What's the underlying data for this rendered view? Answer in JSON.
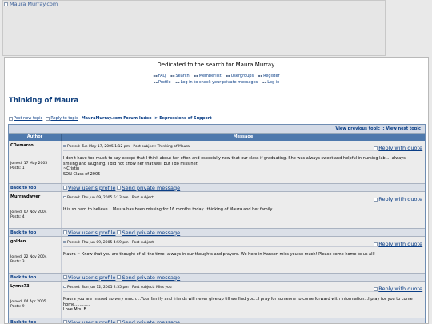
{
  "banner": {
    "alt": "Maura Murray.com"
  },
  "site_description": "Dedicated to the search for Maura Murray.",
  "nav": {
    "row1": [
      {
        "label": "FAQ",
        "icon": "faq-icon"
      },
      {
        "label": "Search",
        "icon": "search-icon"
      },
      {
        "label": "Memberlist",
        "icon": "memberlist-icon"
      },
      {
        "label": "Usergroups",
        "icon": "usergroups-icon"
      },
      {
        "label": "Register",
        "icon": "register-icon"
      }
    ],
    "row2": [
      {
        "label": "Profile",
        "icon": "profile-icon"
      },
      {
        "label": "Log in to check your private messages",
        "icon": "messages-icon"
      },
      {
        "label": "Log in",
        "icon": "login-icon"
      }
    ]
  },
  "topic_title": "Thinking of Maura",
  "buttons": {
    "post_new": "Post new topic",
    "reply_to": "Reply to topic"
  },
  "breadcrumb": {
    "index": "MauraMurray.com Forum Index",
    "arrow": "->",
    "forum": "Expressions of Support"
  },
  "prevnext": {
    "prev": "View previous topic",
    "sep": "::",
    "next": "View next topic"
  },
  "columns": {
    "author": "Author",
    "message": "Message"
  },
  "reply_quote": "Reply with quote",
  "back_to_top": "Back to top",
  "view_profile": "View user's profile",
  "send_pm": "Send private message",
  "posts": [
    {
      "author": "CDemarco",
      "joined": "Joined: 17 May 2005",
      "post_count": "Posts: 1",
      "posted": "Posted: Tue May 17, 2005 1:12 pm",
      "subject": "Post subject: Thinking of Maura",
      "lines": [
        "I don't have too much to say except that I think about her often and especially now that our class if graduating. She was always sweet and helpful in nursing lab ... always",
        "smiling and laughing. I did not know her that well but I do miss her.",
        "~Cristin",
        "SON Class of 2005"
      ]
    },
    {
      "author": "Murraydwyer",
      "joined": "Joined: 07 Nov 2004",
      "post_count": "Posts: 4",
      "posted": "Posted: Thu Jun 09, 2005 6:13 am",
      "subject": "Post subject:",
      "lines": [
        "It is so hard to believe....Maura has been missing for 16 months today...thinking of Maura and her family...."
      ]
    },
    {
      "author": "golden",
      "joined": "Joined: 22 Nov 2004",
      "post_count": "Posts: 3",
      "posted": "Posted: Thu Jun 09, 2005 4:59 pm",
      "subject": "Post subject:",
      "lines": [
        "Maura ~ Know that you are thought of all the time- always in our thoughts and prayers. We here in Hanson miss you so much! Please come home to us all!"
      ]
    },
    {
      "author": "Lynne73",
      "joined": "Joined: 04 Apr 2005",
      "post_count": "Posts: 9",
      "posted": "Posted: Sun Jun 12, 2005 2:55 pm",
      "subject": "Post subject: Miss you",
      "lines": [
        "Maura you are missed so very much....Your family and friends will never give up till we find you...I pray for someone to come forward with information...I pray for you to come",
        "home............",
        "Love Mrs. B"
      ]
    }
  ]
}
